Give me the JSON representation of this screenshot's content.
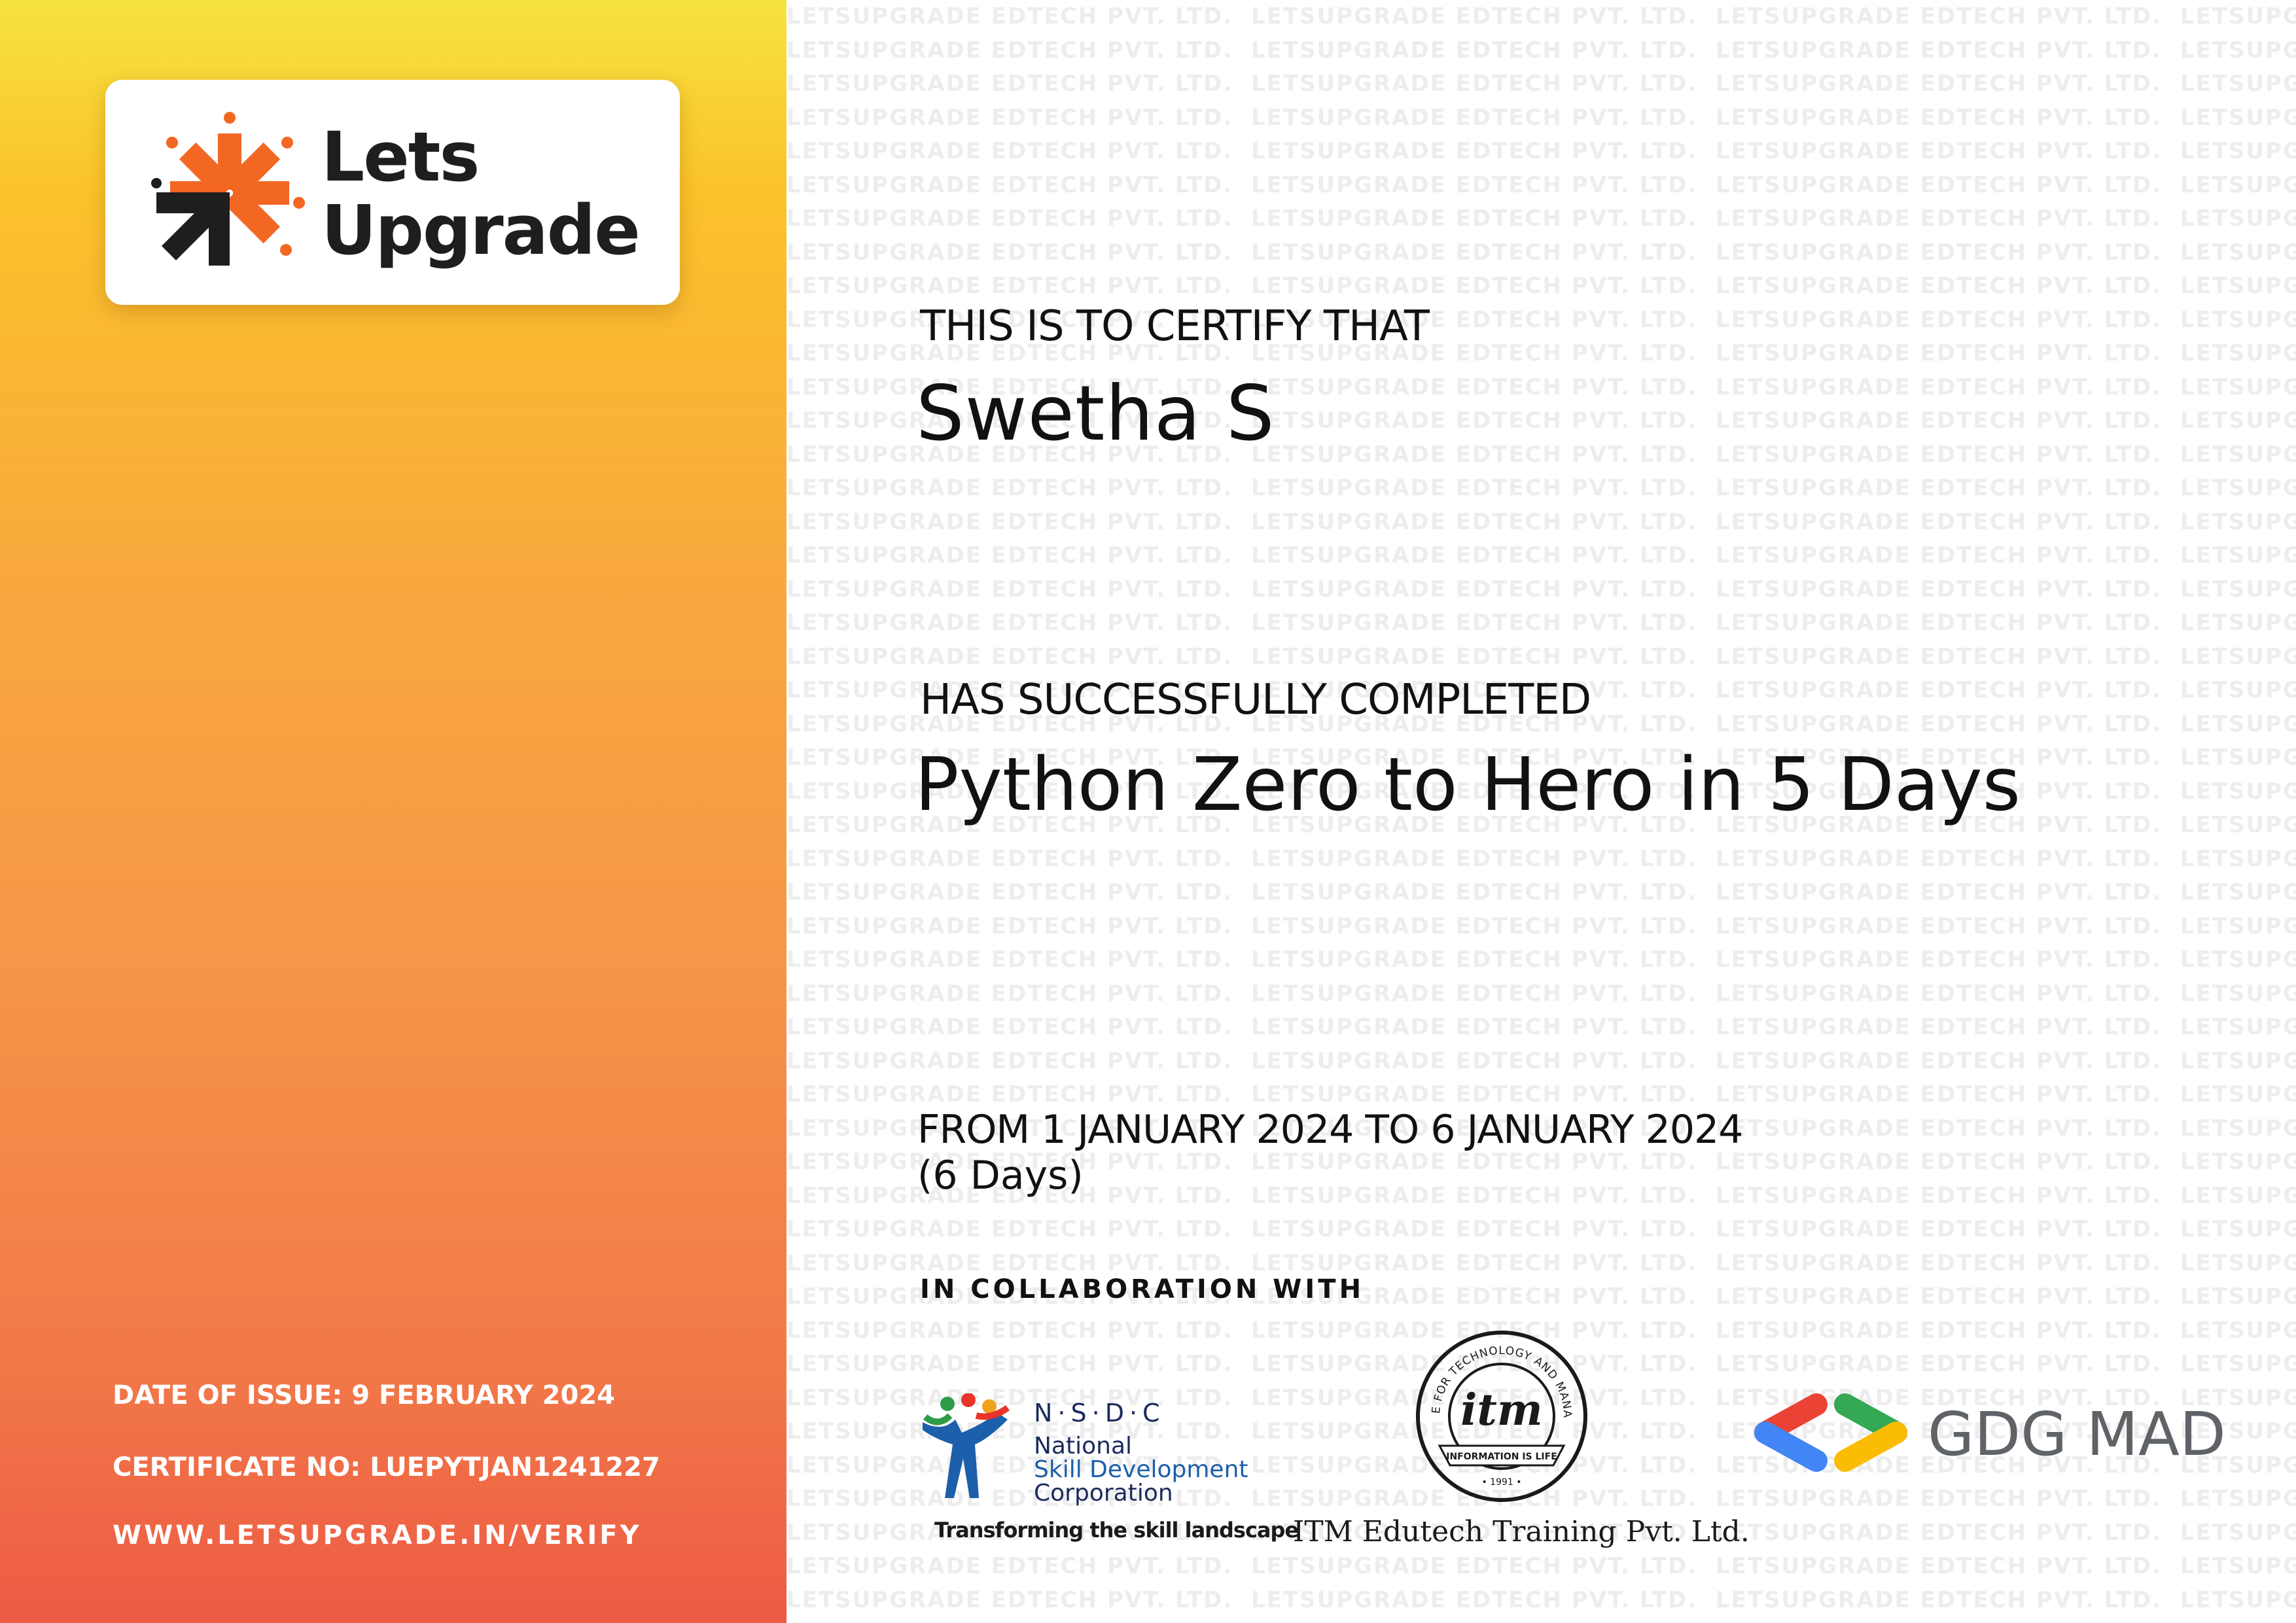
{
  "brand": {
    "logo_line1": "Lets",
    "logo_line2": "Upgrade",
    "colors": {
      "orange": "#f26722",
      "dark": "#1e1e1e",
      "panel_top": "#f6e340",
      "panel_bottom": "#ee5a44"
    },
    "icon": "letsupgrade-arrow-mark-icon"
  },
  "watermark": {
    "text": "LETSUPGRADE EDTECH PVT. LTD."
  },
  "certificate": {
    "intro": "THIS IS TO CERTIFY THAT",
    "recipient": "Swetha S",
    "completion_label": "HAS SUCCESSFULLY COMPLETED",
    "course": "Python Zero to Hero in 5 Days",
    "date_range": "FROM 1 JANUARY 2024 TO 6 JANUARY 2024",
    "duration": "(6 Days)",
    "collaboration_label": "IN COLLABORATION WITH"
  },
  "meta": {
    "date_of_issue": "DATE OF ISSUE: 9 FEBRUARY 2024",
    "certificate_no": "CERTIFICATE NO: LUEPYTJAN1241227",
    "verify_url": "WWW.LETSUPGRADE.IN/VERIFY"
  },
  "partners": {
    "nsdc": {
      "abbr": "N·S·D·C",
      "line1": "National",
      "line2": "Skill Development",
      "line3": "Corporation",
      "tagline": "Transforming the skill landscape",
      "icon": "nsdc-people-figure-icon"
    },
    "itm": {
      "seal_text": "INSTITUTE FOR TECHNOLOGY AND MANAGEMENT",
      "seal_motto": "INFORMATION IS LIFE",
      "seal_year": "• 1991 •",
      "seal_mark": "itm",
      "name": "ITM Edutech Training Pvt. Ltd."
    },
    "gdg": {
      "name": "GDG MAD",
      "icon": "gdg-brackets-icon",
      "colors": [
        "#ea4335",
        "#4285f4",
        "#34a853",
        "#fbbc04"
      ]
    }
  }
}
